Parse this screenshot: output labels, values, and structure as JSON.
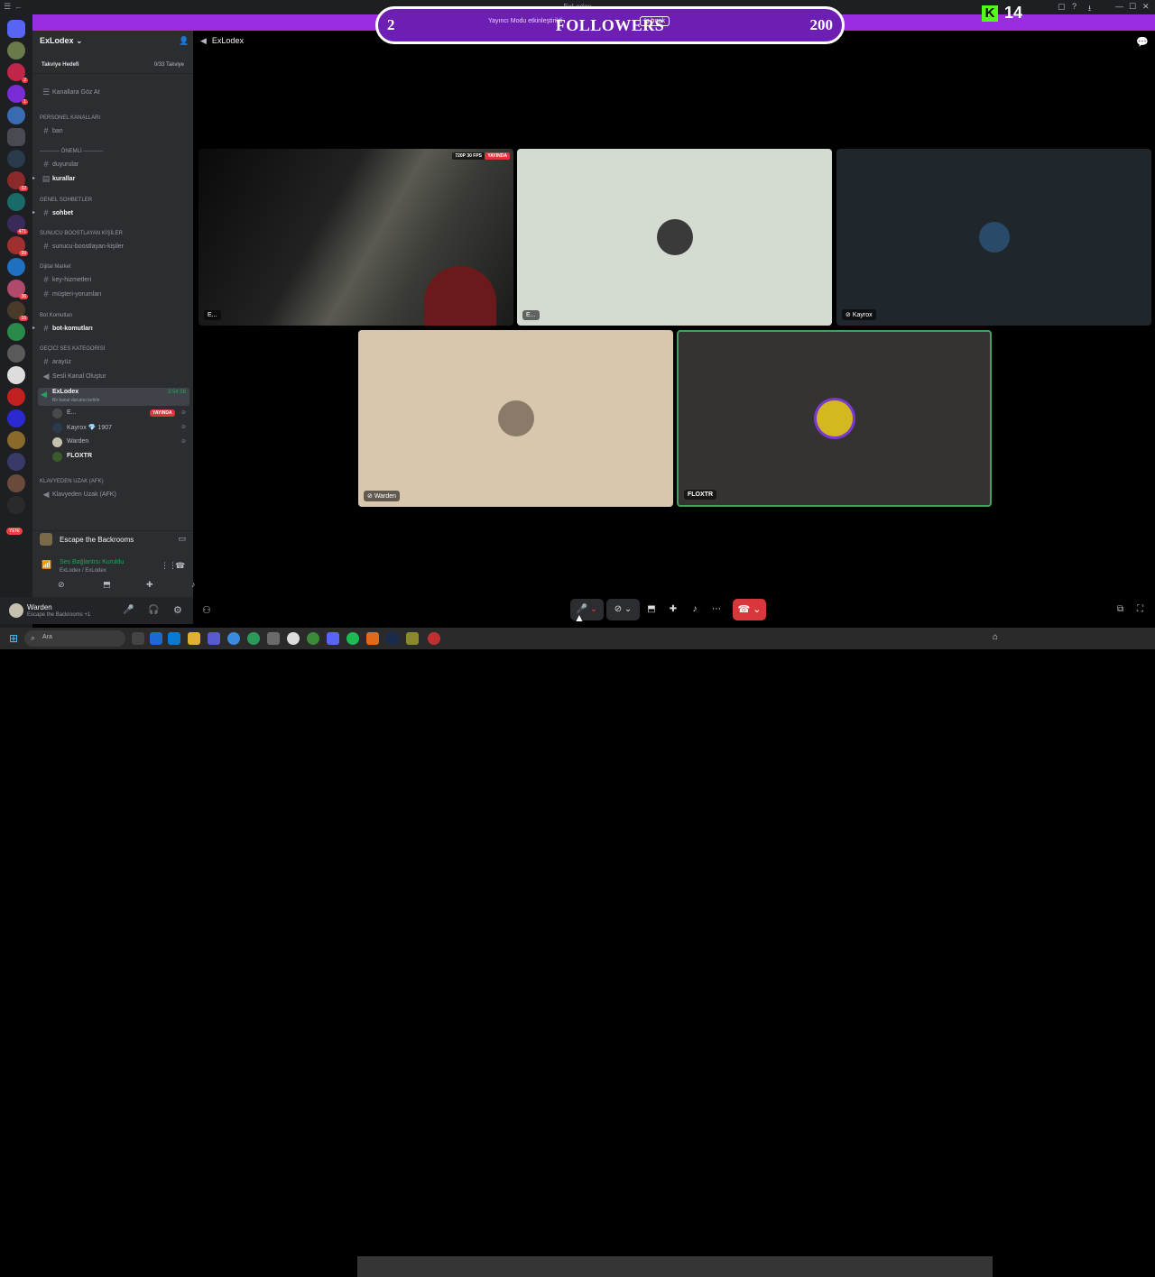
{
  "window": {
    "title": "ExLodex"
  },
  "overlay": {
    "followers_label": "FOLLOWERS",
    "current": "2",
    "goal": "200",
    "kick_count": "14",
    "banner_text": "Yayıncı Modu etkinleştirildi",
    "banner_button": "İş bırak"
  },
  "server": {
    "name": "ExLodex",
    "boost_goal_label": "Takviye Hedefi",
    "boost_goal_value": "0/33 Takviye",
    "browse_channels": "Kanallara Göz At",
    "categories": [
      {
        "name": "PERSONEL KANALLARI",
        "channels": [
          "ban"
        ]
      },
      {
        "name": "----------- ÖNEMLİ -----------",
        "channels": [
          "duyurular",
          "kurallar"
        ]
      },
      {
        "name": "GENEL SOHBETLER",
        "channels": [
          "sohbet"
        ]
      },
      {
        "name": "SUNUCU BOOSTLAYAN KİŞİLER",
        "channels": [
          "sunucu-boostlayan-kişiler"
        ]
      },
      {
        "name": "Dijital Market",
        "channels": [
          "key-hizmetleri",
          "müşteri-yorumları"
        ]
      },
      {
        "name": "Bot Komutları",
        "channels": [
          "bot-komutları"
        ]
      },
      {
        "name": "GEÇİCİ SES KATEGORİSİ",
        "channels": [
          "arayüz",
          "Sesli Kanal Oluştur"
        ]
      },
      {
        "name": "KLAVYEDEN UZAK (AFK)",
        "channels": [
          "Klavyeden Uzak (AFK)"
        ]
      }
    ],
    "voice_channel": {
      "name": "ExLodex",
      "status": "Bir kanal durumu belirle",
      "timer": "3:54:56"
    },
    "voice_users": [
      {
        "name": "E...",
        "live": "YAYINDA"
      },
      {
        "name": "Kayrox",
        "extra": "1907"
      },
      {
        "name": "Warden"
      },
      {
        "name": "FLOXTR"
      }
    ]
  },
  "activity": {
    "game": "Escape the Backrooms"
  },
  "connection": {
    "status": "Ses Bağlantısı Kuruldu",
    "path": "ExLodex / ExLodex"
  },
  "user": {
    "name": "Warden",
    "status": "Escape the Backrooms +1"
  },
  "call": {
    "channel": "ExLodex",
    "tiles": [
      {
        "name": "E...",
        "fps": "720P 30 FPS",
        "live": "YAYINDA",
        "color": "#1a1a1a"
      },
      {
        "name": "E...",
        "color": "#d4dcd2"
      },
      {
        "name": "Kayrox",
        "color": "#1f262c"
      },
      {
        "name": "Warden",
        "color": "#d9c7ad"
      },
      {
        "name": "FLOXTR",
        "color": "#343331",
        "speaking_color": "#3ba55d"
      }
    ]
  },
  "taskbar": {
    "search_placeholder": "Ara"
  },
  "colors": {
    "accent": "#9a2de0",
    "danger": "#da373c",
    "online": "#23a55a",
    "kick": "#53fc18"
  }
}
